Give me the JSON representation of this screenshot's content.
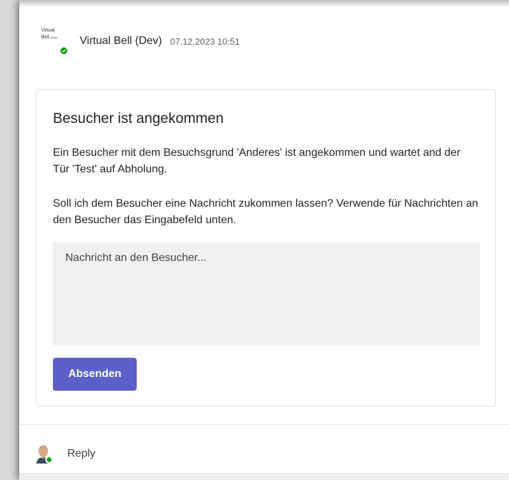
{
  "header": {
    "avatar_text_line1": "Virtual",
    "avatar_text_line2": "Bell",
    "avatar_text_small": "(Dev)",
    "sender": "Virtual Bell (Dev)",
    "timestamp": "07.12.2023 10:51"
  },
  "card": {
    "title": "Besucher ist angekommen",
    "text1": "Ein Besucher mit dem Besuchsgrund 'Anderes' ist angekommen und wartet and der Tür 'Test' auf Abholung.",
    "text2": "Soll ich dem Besucher eine Nachricht zukommen lassen? Verwende für Nachrichten an den Besucher das Eingabefeld unten.",
    "input_placeholder": "Nachricht an den Besucher...",
    "input_value": "",
    "send_label": "Absenden"
  },
  "reply": {
    "label": "Reply"
  },
  "colors": {
    "accent": "#5b5fc7",
    "presence": "#13a10e"
  }
}
